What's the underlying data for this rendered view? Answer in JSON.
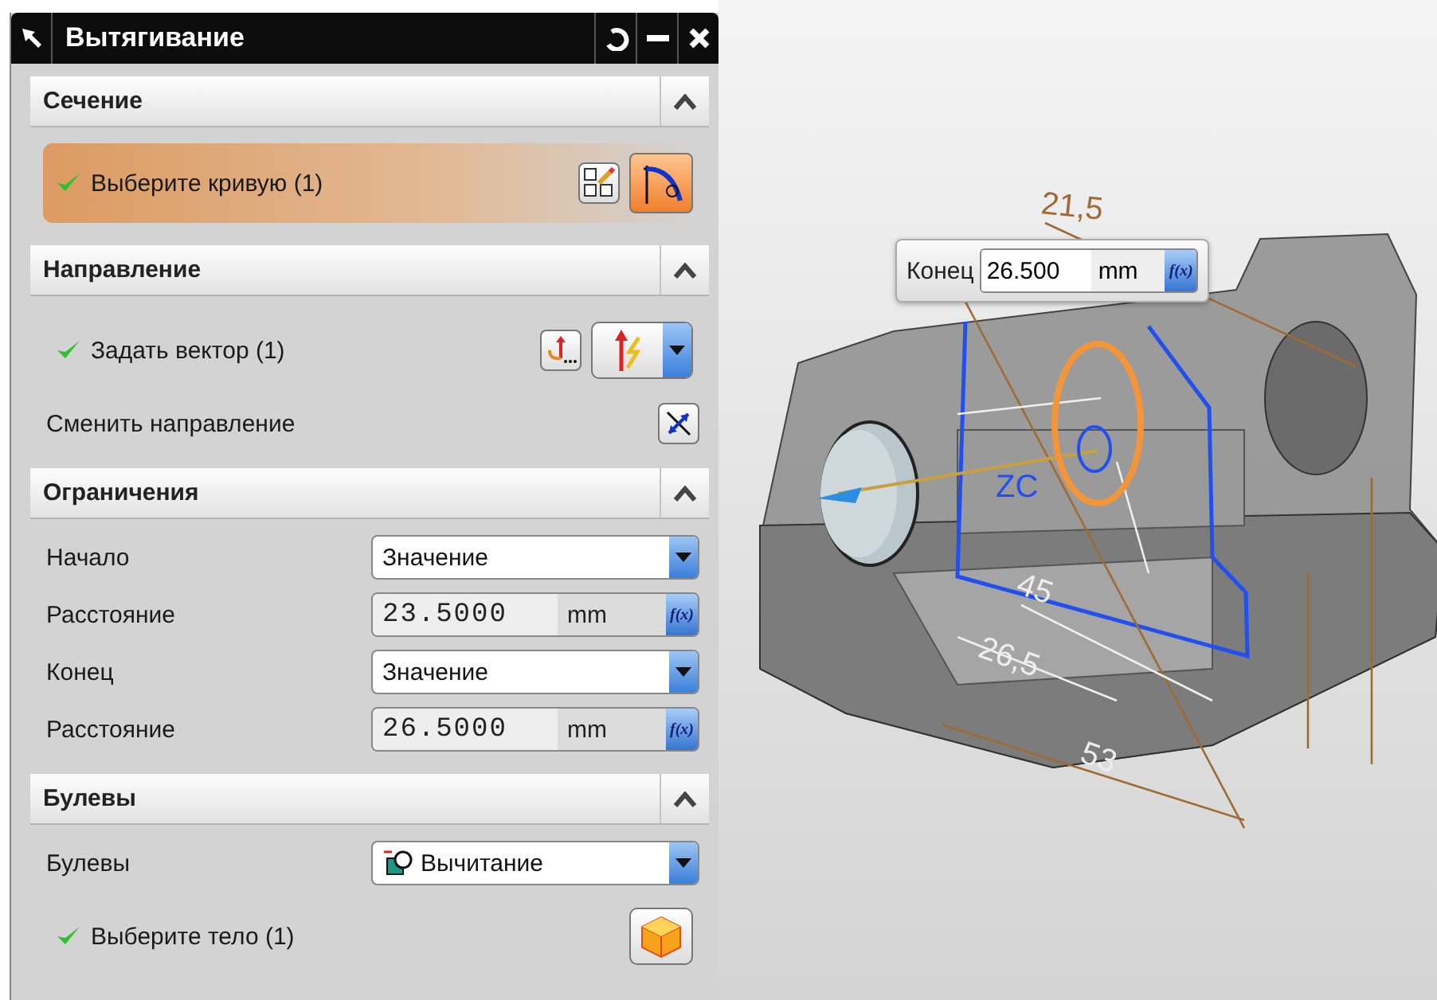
{
  "window": {
    "title": "Вытягивание"
  },
  "sections": [
    {
      "title": "Сечение",
      "expanded": true,
      "rows": [
        {
          "kind": "curve-select",
          "label": "Выберите кривую (1)",
          "done": true,
          "active": true
        }
      ]
    },
    {
      "title": "Направление",
      "expanded": true,
      "rows": [
        {
          "kind": "vector-select",
          "label": "Задать вектор (1)",
          "done": true,
          "active": false
        },
        {
          "kind": "reverse",
          "label": "Сменить направление"
        }
      ]
    },
    {
      "title": "Ограничения",
      "expanded": true,
      "rows": [
        {
          "kind": "dropdown",
          "label": "Начало",
          "value": "Значение"
        },
        {
          "kind": "expression",
          "label": "Расстояние",
          "value": "23.5000",
          "unit": "mm",
          "fx": "f(x)"
        },
        {
          "kind": "dropdown",
          "label": "Конец",
          "value": "Значение"
        },
        {
          "kind": "expression",
          "label": "Расстояние",
          "value": "26.5000",
          "unit": "mm",
          "fx": "f(x)"
        }
      ]
    },
    {
      "title": "Булевы",
      "expanded": true,
      "rows": [
        {
          "kind": "boolean-dropdown",
          "label": "Булевы",
          "value": "Вычитание"
        },
        {
          "kind": "body-select",
          "label": "Выберите тело (1)",
          "done": true,
          "active": false
        }
      ]
    }
  ],
  "viewport": {
    "labels": [
      {
        "kind": "dimension",
        "text": "21,5"
      },
      {
        "kind": "axis",
        "text": "ZC"
      },
      {
        "kind": "dimension",
        "text": "45"
      },
      {
        "kind": "dimension",
        "text": "26,5"
      },
      {
        "kind": "dimension",
        "text": "53"
      }
    ],
    "handle": {
      "label": "Конец",
      "value": "26.500",
      "unit": "mm",
      "fx": "f(x)"
    }
  }
}
